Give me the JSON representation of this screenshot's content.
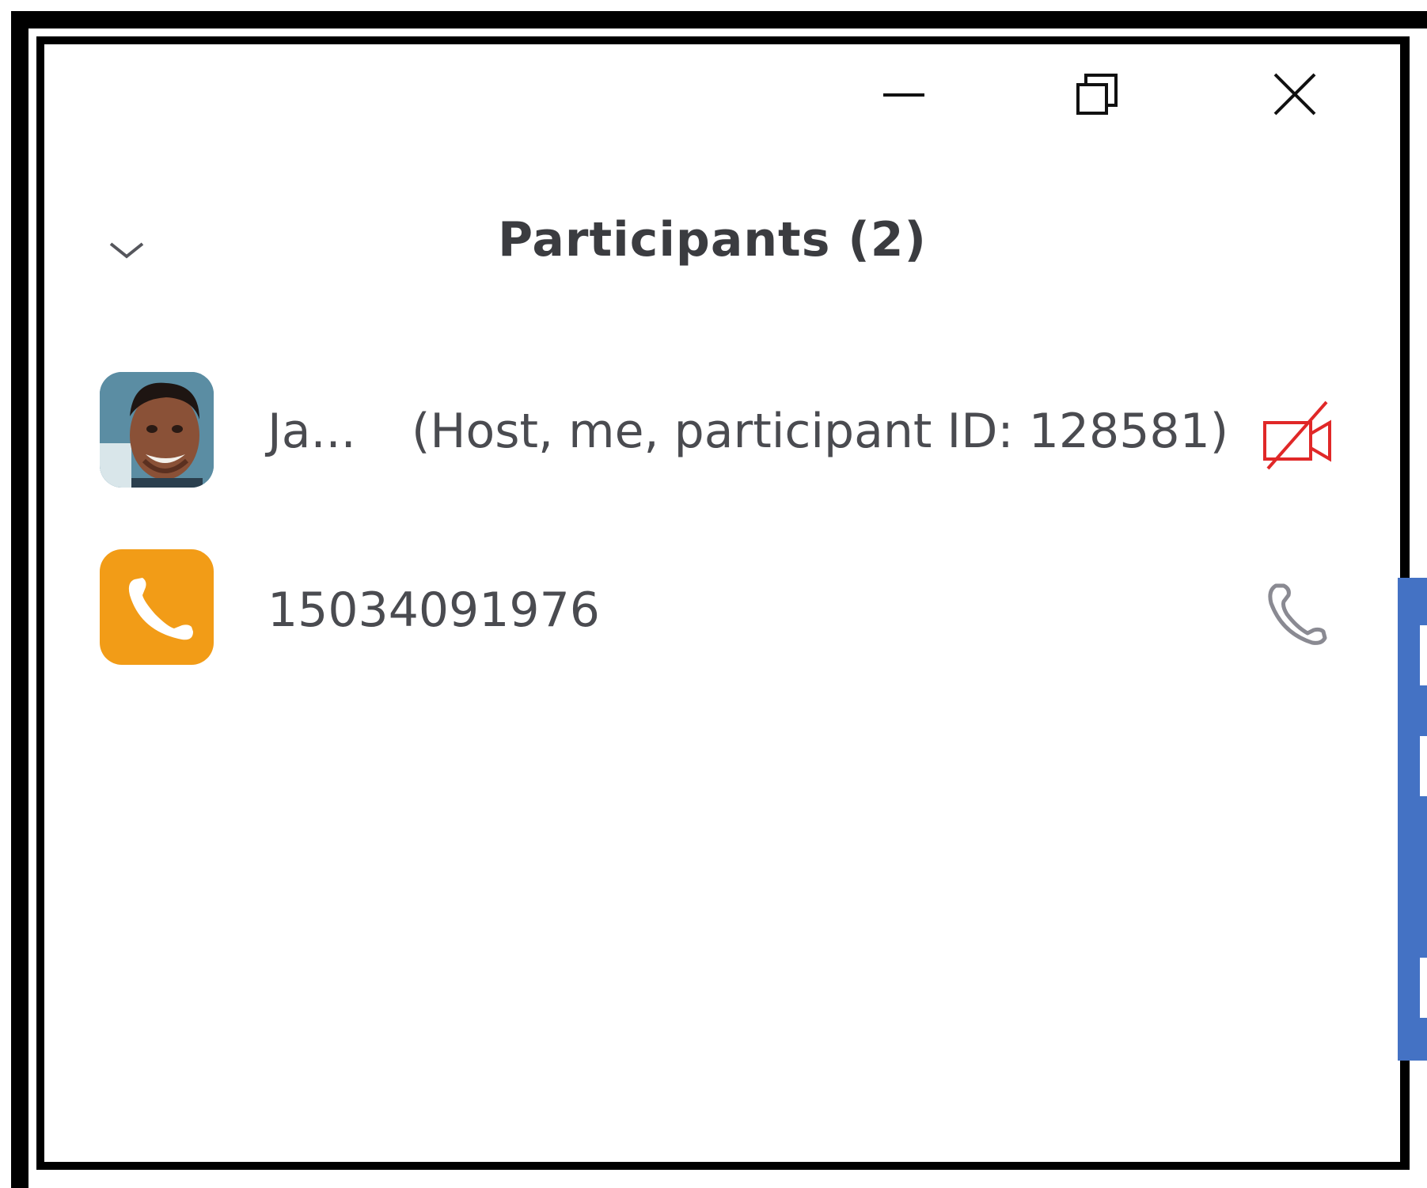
{
  "window": {
    "controls": {
      "minimize_icon": "minimize-icon",
      "restore_icon": "restore-icon",
      "close_icon": "close-icon"
    }
  },
  "panel": {
    "collapse_icon": "chevron-down-icon",
    "title": "Participants (2)"
  },
  "participants": [
    {
      "name": "Ja...",
      "role": "(Host, me, participant ID: 128581)",
      "avatar": "user-photo",
      "status_icon": "video-off-icon",
      "status_color": "#e02828"
    },
    {
      "name": "15034091976",
      "avatar": "phone-avatar",
      "avatar_color": "#f29c17",
      "status_icon": "phone-icon",
      "status_color": "#8a8a92"
    }
  ],
  "colors": {
    "title_text": "#3b3c40",
    "body_text": "#4a4b50",
    "accent_strip": "#4472c4"
  }
}
